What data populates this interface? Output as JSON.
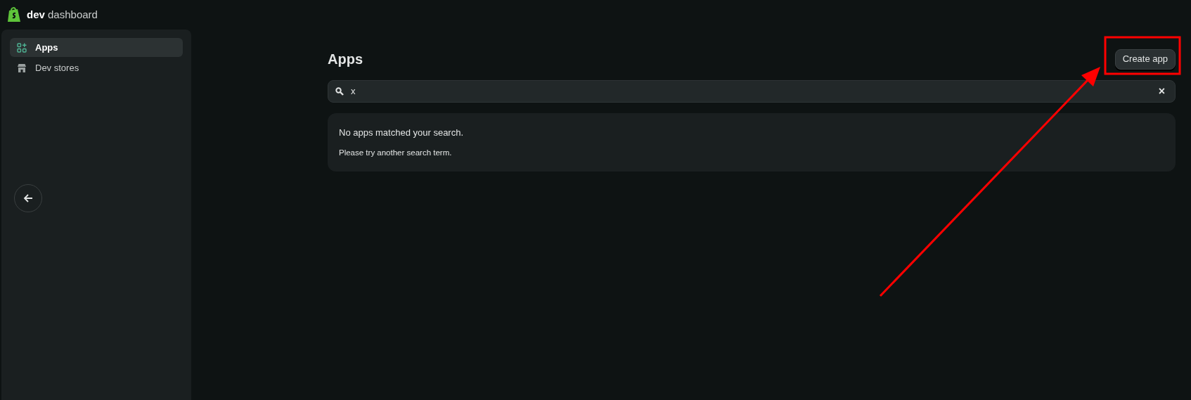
{
  "header": {
    "brand_bold": "dev",
    "brand_rest": "dashboard"
  },
  "sidebar": {
    "items": [
      {
        "label": "Apps",
        "selected": true,
        "kind": "apps"
      },
      {
        "label": "Dev stores",
        "selected": false,
        "kind": "store"
      }
    ]
  },
  "main": {
    "title": "Apps",
    "create_button": "Create app",
    "search": {
      "value": "x"
    },
    "clear_button": "×",
    "empty_state": {
      "heading": "No apps matched your search.",
      "body": "Please try another search term."
    }
  },
  "annotation": {
    "highlight": true,
    "arrow": true
  }
}
